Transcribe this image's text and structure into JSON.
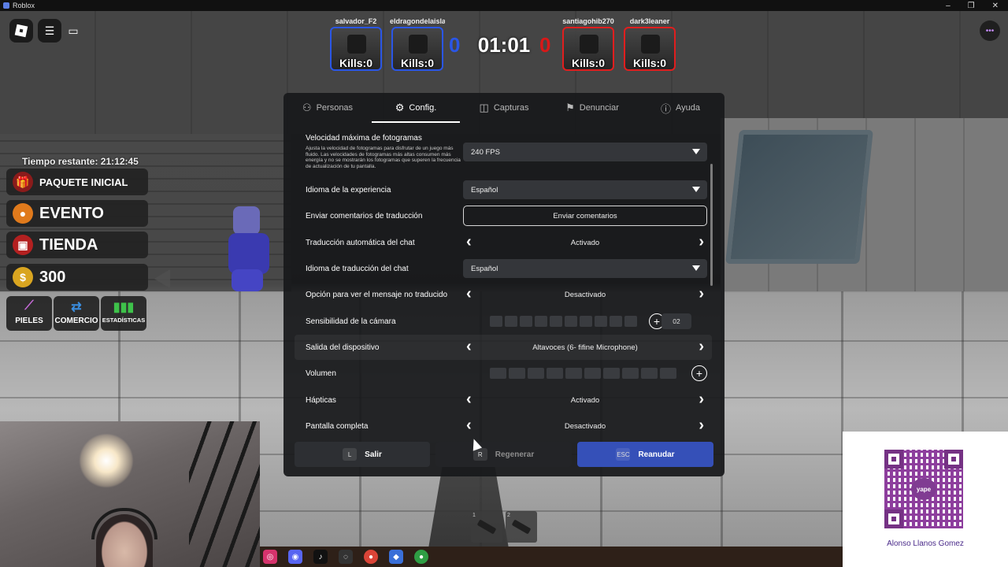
{
  "window": {
    "title": "Roblox"
  },
  "scoreboard": {
    "blue_players": [
      {
        "name": "salvador_F2",
        "kills": "Kills:0"
      },
      {
        "name": "eldragondelaisla",
        "kills": "Kills:0"
      }
    ],
    "red_players": [
      {
        "name": "santiagohib270",
        "kills": "Kills:0"
      },
      {
        "name": "dark3leaner",
        "kills": "Kills:0"
      }
    ],
    "blue_score": "0",
    "red_score": "0",
    "timer": "01:01",
    "colors": {
      "blue": "#2a56e6",
      "red": "#d81818"
    }
  },
  "game_menu": {
    "time_left": "Tiempo restante: 21:12:45",
    "buttons": [
      {
        "label": "PAQUETE INICIAL",
        "icon": "gift-icon"
      },
      {
        "label": "EVENTO",
        "icon": "pumpkin-icon"
      },
      {
        "label": "TIENDA",
        "icon": "shop-icon"
      },
      {
        "label": "300",
        "icon": "coin-icon"
      }
    ],
    "small_buttons": [
      {
        "label": "PIELES",
        "icon": "knife-icon"
      },
      {
        "label": "COMERCIO",
        "icon": "trade-icon"
      },
      {
        "label": "ESTADÍSTICAS",
        "icon": "chart-icon"
      }
    ]
  },
  "tabs": [
    {
      "label": "Personas",
      "icon": "people-icon"
    },
    {
      "label": "Config.",
      "icon": "gear-icon",
      "active": true
    },
    {
      "label": "Capturas",
      "icon": "camera-icon"
    },
    {
      "label": "Denunciar",
      "icon": "flag-icon"
    },
    {
      "label": "Ayuda",
      "icon": "help-icon"
    }
  ],
  "settings": {
    "fps": {
      "label": "Velocidad máxima de fotogramas",
      "description": "Ajusta la velocidad de fotogramas para disfrutar de un juego más fluido. Las velocidades de fotogramas más altas consumen más energía y no se mostrarán los fotogramas que superen la frecuencia de actualización de tu pantalla.",
      "value": "240 FPS"
    },
    "experience_language": {
      "label": "Idioma de la experiencia",
      "value": "Español"
    },
    "translation_feedback": {
      "label": "Enviar comentarios de traducción",
      "button": "Enviar comentarios"
    },
    "chat_auto_translate": {
      "label": "Traducción automática del chat",
      "value": "Activado"
    },
    "chat_translate_language": {
      "label": "Idioma de traducción del chat",
      "value": "Español"
    },
    "show_untranslated": {
      "label": "Opción para ver el mensaje no traducido",
      "value": "Desactivado"
    },
    "camera_sensitivity": {
      "label": "Sensibilidad de la cámara",
      "value": "02"
    },
    "output_device": {
      "label": "Salida del dispositivo",
      "value": "Altavoces (6- fifine Microphone)"
    },
    "volume": {
      "label": "Volumen"
    },
    "haptics": {
      "label": "Hápticas",
      "value": "Activado"
    },
    "fullscreen": {
      "label": "Pantalla completa",
      "value": "Desactivado"
    }
  },
  "footer": {
    "exit": {
      "key": "L",
      "label": "Salir"
    },
    "regen": {
      "key": "R",
      "label": "Regenerar"
    },
    "resume": {
      "key": "ESC",
      "label": "Reanudar"
    }
  },
  "hotbar": [
    "1",
    "2"
  ],
  "qr": {
    "badge": "yape",
    "name": "Alonso Llanos Gomez"
  }
}
